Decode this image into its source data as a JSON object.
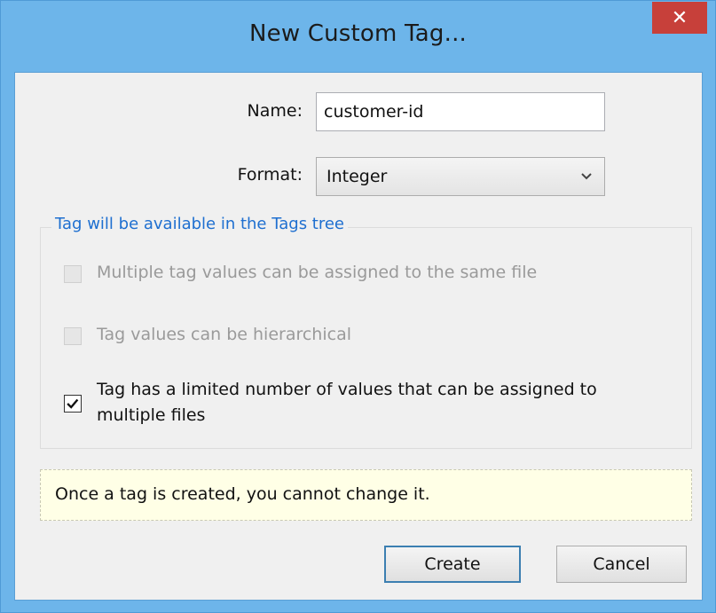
{
  "window": {
    "title": "New Custom Tag...",
    "close_icon": "close-icon"
  },
  "form": {
    "name_label": "Name:",
    "name_value": "customer-id",
    "format_label": "Format:",
    "format_value": "Integer"
  },
  "group": {
    "title": "Tag will be available in the Tags tree",
    "options": [
      {
        "label": "Multiple tag values can be assigned to the same file",
        "checked": false,
        "enabled": false
      },
      {
        "label": "Tag values can be hierarchical",
        "checked": false,
        "enabled": false
      },
      {
        "label_line1": "Tag has a limited number of values that can be assigned to",
        "label_line2": "multiple files",
        "checked": true,
        "enabled": true
      }
    ]
  },
  "notice": {
    "text": "Once a tag is created, you cannot change it."
  },
  "buttons": {
    "create": "Create",
    "cancel": "Cancel"
  },
  "colors": {
    "titlebar": "#6db5ea",
    "close_button": "#c7403a",
    "group_title": "#1e6fd0",
    "notice_bg": "#ffffe6"
  }
}
